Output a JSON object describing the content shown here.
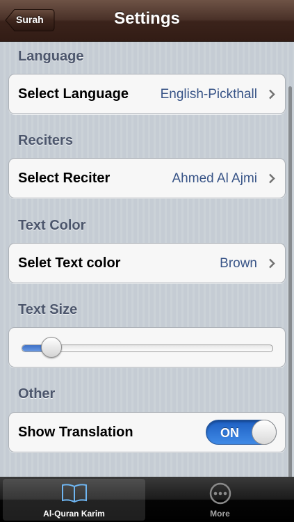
{
  "navbar": {
    "title": "Settings",
    "back_label": "Surah"
  },
  "sections": {
    "language": {
      "header": "Language",
      "label": "Select Language",
      "value": "English-Pickthall"
    },
    "reciters": {
      "header": "Reciters",
      "label": "Select Reciter",
      "value": "Ahmed Al Ajmi"
    },
    "text_color": {
      "header": "Text Color",
      "label": "Selet Text color",
      "value": "Brown"
    },
    "text_size": {
      "header": "Text Size",
      "slider_level": 0.1
    },
    "other": {
      "header": "Other",
      "label": "Show Translation",
      "toggle_state": "ON"
    }
  },
  "tabbar": {
    "tabs": [
      {
        "label": "Al-Quran Karim",
        "icon": "book-icon",
        "active": true
      },
      {
        "label": "More",
        "icon": "more-icon",
        "active": false
      }
    ]
  },
  "colors": {
    "navbar": "#4a3128",
    "accent": "#3f8ae6",
    "value_text": "#385487"
  }
}
